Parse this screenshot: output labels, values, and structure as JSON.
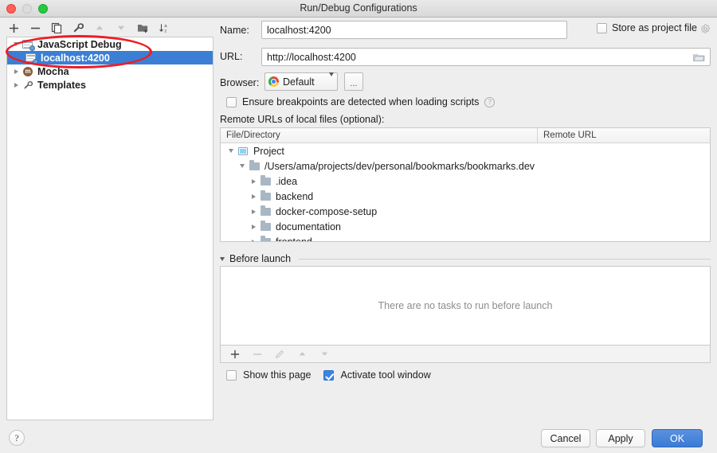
{
  "window": {
    "title": "Run/Debug Configurations",
    "controls": [
      "close",
      "minimize",
      "zoom"
    ]
  },
  "left_toolbar": {
    "items": [
      {
        "name": "add-button",
        "glyph": "+",
        "disabled": false
      },
      {
        "name": "remove-button",
        "glyph": "−",
        "disabled": false
      },
      {
        "name": "copy-configuration-button",
        "glyph": "❐",
        "disabled": false
      },
      {
        "name": "edit-templates-button",
        "glyph": "🔧",
        "disabled": false
      },
      {
        "name": "move-up-button",
        "glyph": "▲",
        "disabled": true
      },
      {
        "name": "move-down-button",
        "glyph": "▼",
        "disabled": true
      },
      {
        "name": "create-folder-button",
        "glyph": "🗁",
        "disabled": false
      },
      {
        "name": "sort-configurations-button",
        "glyph": "↓",
        "disabled": false
      }
    ]
  },
  "config_tree": {
    "items": [
      {
        "label": "JavaScript Debug",
        "indent": 0,
        "icon": "js-debug-icon",
        "twisty": "down",
        "bold": true,
        "selected": false
      },
      {
        "label": "localhost:4200",
        "indent": 1,
        "icon": "js-debug-icon",
        "twisty": "none",
        "bold": true,
        "selected": true
      },
      {
        "label": "Mocha",
        "indent": 0,
        "icon": "mocha-icon",
        "twisty": "right",
        "bold": true,
        "selected": false
      },
      {
        "label": "Templates",
        "indent": 0,
        "icon": "wrench-icon",
        "twisty": "right",
        "bold": true,
        "selected": false
      }
    ]
  },
  "annotation": {
    "shape": "ellipse",
    "color": "#ee1c25"
  },
  "form": {
    "name_label": "Name:",
    "name_value": "localhost:4200",
    "store_as_project_file_label": "Store as project file",
    "store_as_project_file_checked": false,
    "url_label": "URL:",
    "url_value": "http://localhost:4200",
    "browser_label": "Browser:",
    "browser_value": "Default",
    "browser_more_label": "...",
    "ensure_breakpoints_label": "Ensure breakpoints are detected when loading scripts",
    "ensure_breakpoints_checked": false,
    "remote_urls_label": "Remote URLs of local files (optional):"
  },
  "file_table": {
    "columns": [
      "File/Directory",
      "Remote URL"
    ],
    "rows": [
      {
        "label": "Project",
        "indent": 0,
        "twisty": "down",
        "icon": "project-icon",
        "remote_url": ""
      },
      {
        "label": "/Users/ama/projects/dev/personal/bookmarks/bookmarks.dev",
        "indent": 1,
        "twisty": "down",
        "icon": "folder-icon",
        "remote_url": ""
      },
      {
        "label": ".idea",
        "indent": 2,
        "twisty": "right",
        "icon": "folder-icon",
        "remote_url": ""
      },
      {
        "label": "backend",
        "indent": 2,
        "twisty": "right",
        "icon": "folder-icon",
        "remote_url": ""
      },
      {
        "label": "docker-compose-setup",
        "indent": 2,
        "twisty": "right",
        "icon": "folder-icon",
        "remote_url": ""
      },
      {
        "label": "documentation",
        "indent": 2,
        "twisty": "right",
        "icon": "folder-icon",
        "remote_url": ""
      },
      {
        "label": "frontend",
        "indent": 2,
        "twisty": "right",
        "icon": "folder-icon",
        "remote_url": ""
      }
    ]
  },
  "before_launch": {
    "section_title": "Before launch",
    "empty_message": "There are no tasks to run before launch",
    "toolbar": [
      {
        "name": "add-task-button",
        "glyph": "+",
        "disabled": false
      },
      {
        "name": "remove-task-button",
        "glyph": "−",
        "disabled": true
      },
      {
        "name": "edit-task-button",
        "glyph": "✎",
        "disabled": true
      },
      {
        "name": "move-task-up-button",
        "glyph": "▲",
        "disabled": true
      },
      {
        "name": "move-task-down-button",
        "glyph": "▼",
        "disabled": true
      }
    ],
    "show_this_page_label": "Show this page",
    "show_this_page_checked": false,
    "activate_tool_window_label": "Activate tool window",
    "activate_tool_window_checked": true
  },
  "footer": {
    "help_glyph": "?",
    "cancel_label": "Cancel",
    "apply_label": "Apply",
    "ok_label": "OK",
    "ok_color": "#3b7ad4"
  }
}
